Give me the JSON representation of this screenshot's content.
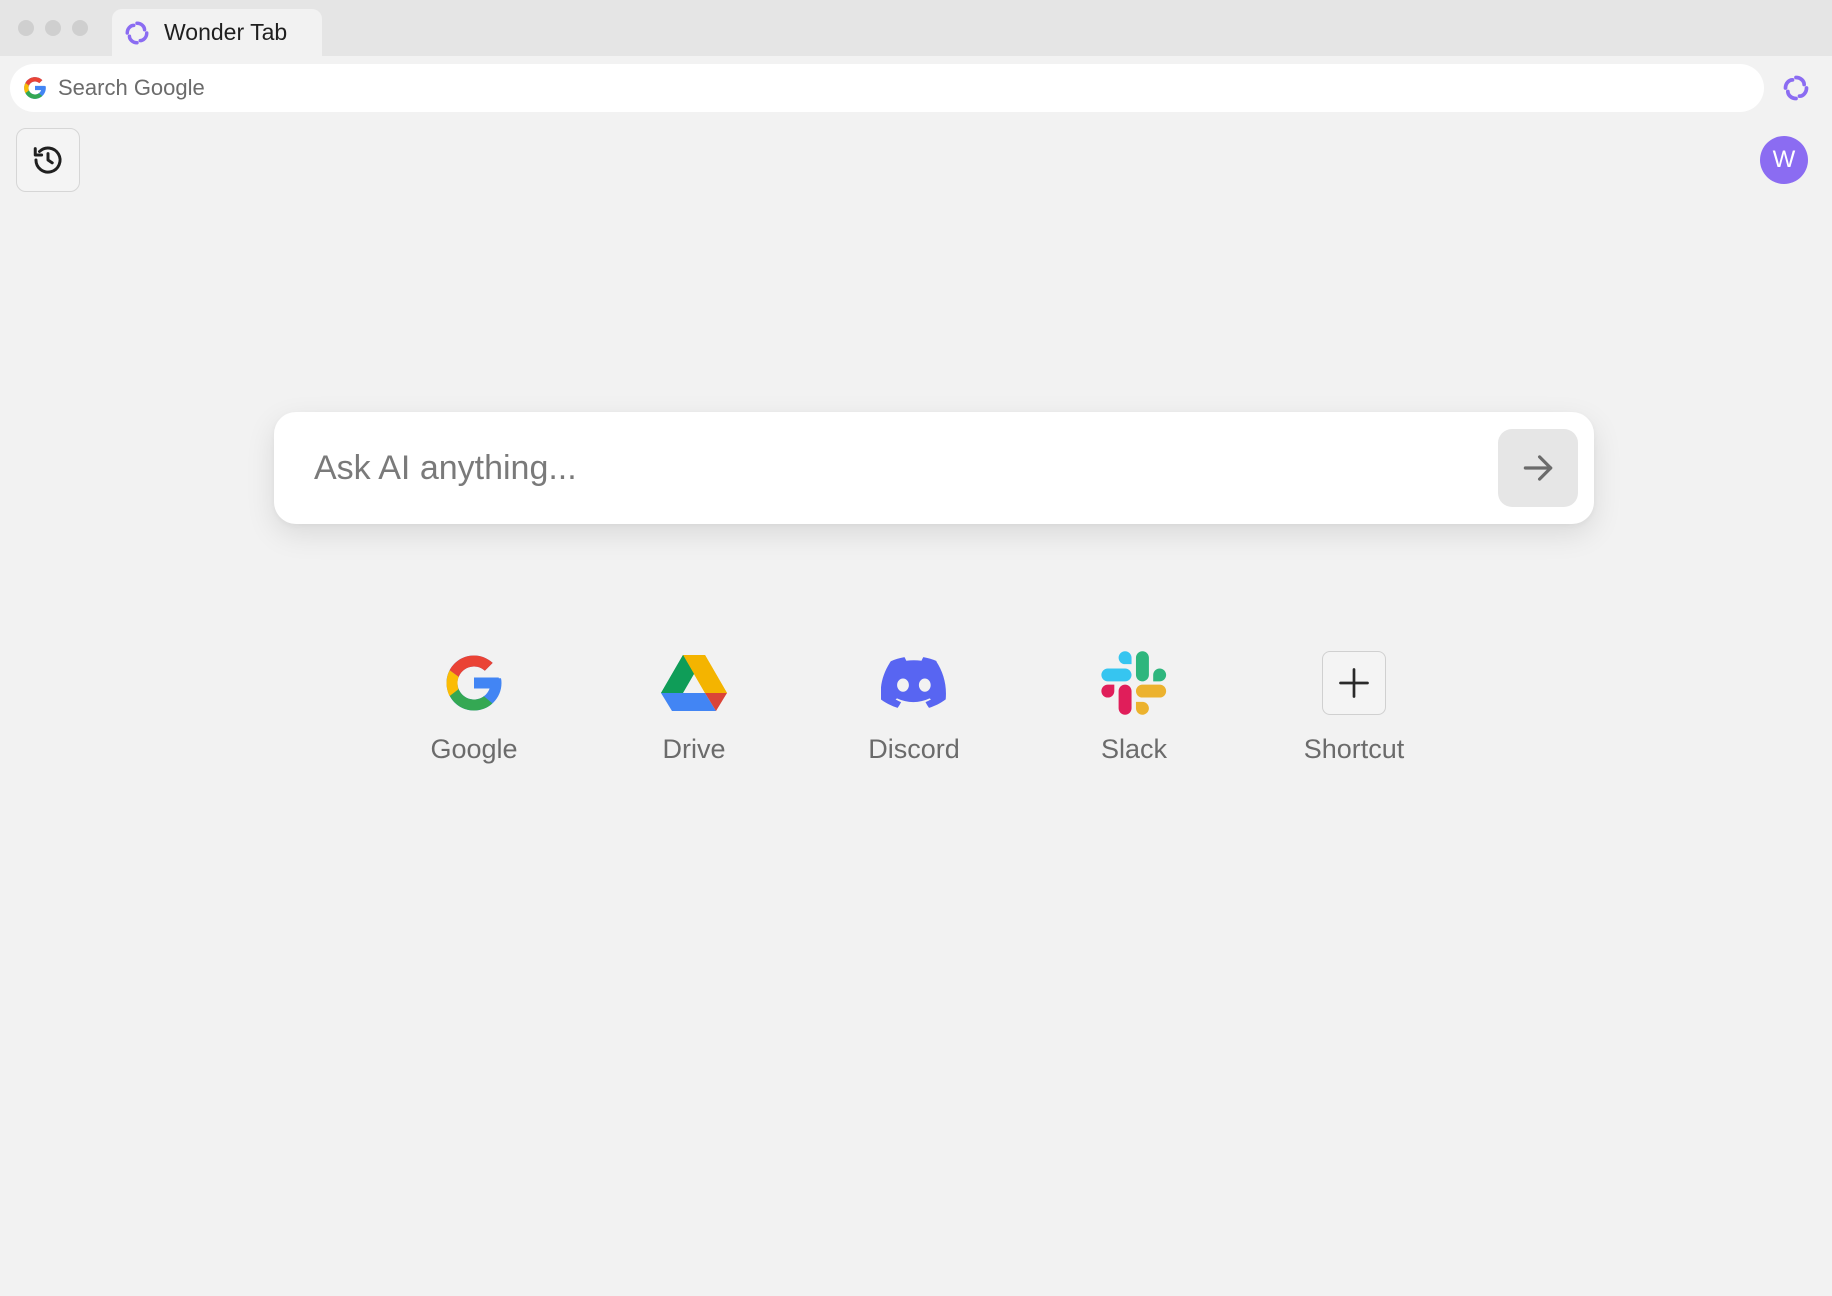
{
  "tab": {
    "title": "Wonder Tab"
  },
  "address_bar": {
    "placeholder": "Search Google"
  },
  "avatar": {
    "initial": "W",
    "color": "#8b6cf2"
  },
  "ask": {
    "placeholder": "Ask AI anything..."
  },
  "shortcuts": [
    {
      "label": "Google",
      "icon": "google-icon"
    },
    {
      "label": "Drive",
      "icon": "google-drive-icon"
    },
    {
      "label": "Discord",
      "icon": "discord-icon"
    },
    {
      "label": "Slack",
      "icon": "slack-icon"
    },
    {
      "label": "Shortcut",
      "icon": "plus-icon"
    }
  ],
  "colors": {
    "accent": "#8b6cf2",
    "background": "#f2f2f2"
  }
}
